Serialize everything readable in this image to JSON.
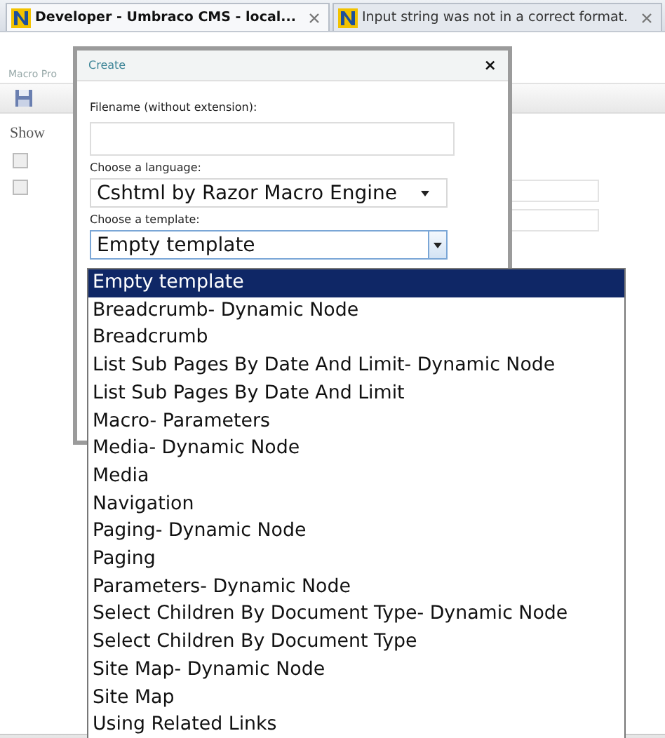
{
  "browser_tabs": [
    {
      "title": "Developer - Umbraco CMS - local...",
      "selected": true
    },
    {
      "title": "Input string was not in a correct format.",
      "selected": false
    }
  ],
  "page": {
    "tab_label": "Macro Pro",
    "show_label": "Show",
    "checkboxes": [
      {
        "checked": false
      },
      {
        "checked": false
      }
    ]
  },
  "dialog": {
    "title": "Create",
    "close": "×",
    "filename_label": "Filename (without extension):",
    "language_label": "Choose a language:",
    "language_value": "Cshtml by Razor Macro Engine",
    "template_label": "Choose a template:",
    "template_value": "Empty template"
  },
  "template_options": [
    {
      "label": "Empty template",
      "selected": true
    },
    {
      "label": "Breadcrumb- Dynamic Node",
      "selected": false
    },
    {
      "label": "Breadcrumb",
      "selected": false
    },
    {
      "label": "List Sub Pages By Date And Limit- Dynamic Node",
      "selected": false
    },
    {
      "label": "List Sub Pages By Date And Limit",
      "selected": false
    },
    {
      "label": "Macro- Parameters",
      "selected": false
    },
    {
      "label": "Media- Dynamic Node",
      "selected": false
    },
    {
      "label": "Media",
      "selected": false
    },
    {
      "label": "Navigation",
      "selected": false
    },
    {
      "label": "Paging- Dynamic Node",
      "selected": false
    },
    {
      "label": "Paging",
      "selected": false
    },
    {
      "label": "Parameters- Dynamic Node",
      "selected": false
    },
    {
      "label": "Select Children By Document Type- Dynamic Node",
      "selected": false
    },
    {
      "label": "Select Children By Document Type",
      "selected": false
    },
    {
      "label": "Site Map- Dynamic Node",
      "selected": false
    },
    {
      "label": "Site Map",
      "selected": false
    },
    {
      "label": "Using Related Links",
      "selected": false
    }
  ]
}
